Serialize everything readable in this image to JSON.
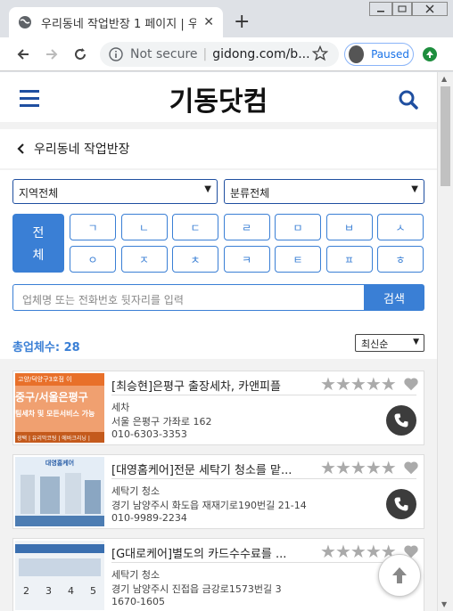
{
  "browser": {
    "tab_title": "우리동네 작업반장 1 페이지 | 우",
    "tab_close": "✕",
    "new_tab": "+",
    "not_secure": "Not secure",
    "url": "gidong.com/b...",
    "profile_status": "Paused"
  },
  "site": {
    "logo": "기동닷컴",
    "breadcrumb": "우리동네 작업반장"
  },
  "filters": {
    "region_select": "지역전체",
    "category_select": "분류전체",
    "all_label_1": "전",
    "all_label_2": "체",
    "consonants": [
      "ㄱ",
      "ㄴ",
      "ㄷ",
      "ㄹ",
      "ㅁ",
      "ㅂ",
      "ㅅ",
      "ㅇ",
      "ㅈ",
      "ㅊ",
      "ㅋ",
      "ㅌ",
      "ㅍ",
      "ㅎ"
    ],
    "search_placeholder": "업체명 또는 전화번호 뒷자리를 입력",
    "search_button": "검색",
    "total_label": "총업체수: 28",
    "sort_select": "최신순"
  },
  "listings": [
    {
      "title": "[최승현]은평구 출장세차, 카앤피플",
      "category": "세차",
      "address": "서울 은평구 가좌로 162",
      "phone": "010-6303-3353",
      "rating": 0,
      "thumb_lines": [
        "고양/덕양구3호점 이",
        "중구/서울은평구",
        "팀세차 및 모든서비스 가능",
        "광택 | 유리막코팅 | 에바크리닝 |"
      ]
    },
    {
      "title": "[대영홈케어]전문 세탁기 청소를 맡...",
      "category": "세탁기 청소",
      "address": "경기 남양주시 화도읍 재재기로190번길 21-14",
      "phone": "010-9989-2234",
      "rating": 0,
      "thumb_lines": [
        "대영홈케어"
      ]
    },
    {
      "title": "[G대로케어]별도의 카드수수료를 ...",
      "category": "세탁기 청소",
      "address": "경기 남양주시 진접읍 금강로1573번길 3",
      "phone": "1670-1605",
      "rating": 0,
      "thumb_lines": [
        "2",
        "3",
        "4",
        "5"
      ]
    }
  ],
  "icons": {
    "favicon": "globe-icon",
    "menu": "hamburger-icon",
    "search": "search-icon",
    "back": "chevron-left-icon",
    "star": "star-icon",
    "heart": "heart-icon",
    "call": "phone-icon",
    "to_top": "arrow-up-icon"
  },
  "colors": {
    "accent": "#3a7fd5",
    "header_icon": "#1f4fa0",
    "thumb_orange": "#e8702a"
  }
}
